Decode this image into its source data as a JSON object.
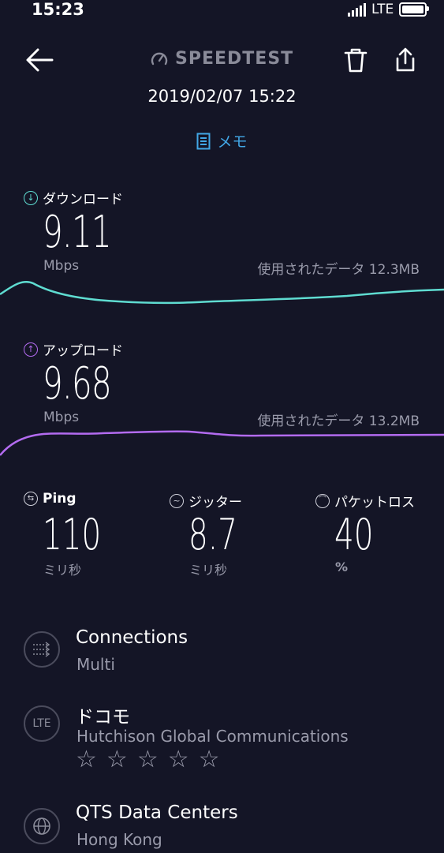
{
  "status_bar": {
    "time": "15:23",
    "network": "LTE"
  },
  "header": {
    "logo": "SPEEDTEST",
    "datetime": "2019/02/07 15:22",
    "memo_label": "メモ"
  },
  "download": {
    "label": "ダウンロード",
    "value": "9.11",
    "unit": "Mbps",
    "data_used": "使用されたデータ 12.3MB",
    "color": "#5fdcd1"
  },
  "upload": {
    "label": "アップロード",
    "value": "9.68",
    "unit": "Mbps",
    "data_used": "使用されたデータ 13.2MB",
    "color": "#b36bf0"
  },
  "stats": {
    "ping": {
      "label": "Ping",
      "value": "110",
      "unit": "ミリ秒"
    },
    "jitter": {
      "label": "ジッター",
      "value": "8.7",
      "unit": "ミリ秒"
    },
    "packet_loss": {
      "label": "パケットロス",
      "value": "40",
      "unit": "%"
    }
  },
  "connections": {
    "title": "Connections",
    "value": "Multi"
  },
  "provider": {
    "icon_text": "LTE",
    "name": "ドコモ",
    "isp": "Hutchison Global Communications",
    "rating_stars": 5,
    "rating_filled": 0
  },
  "server": {
    "name": "QTS Data Centers",
    "location": "Hong Kong"
  },
  "icons": [
    "back-arrow-icon",
    "speedometer-icon",
    "trash-icon",
    "share-icon",
    "memo-icon",
    "download-icon",
    "upload-icon",
    "ping-icon",
    "jitter-icon",
    "packet-loss-icon",
    "connections-icon",
    "globe-icon",
    "star-icon"
  ]
}
